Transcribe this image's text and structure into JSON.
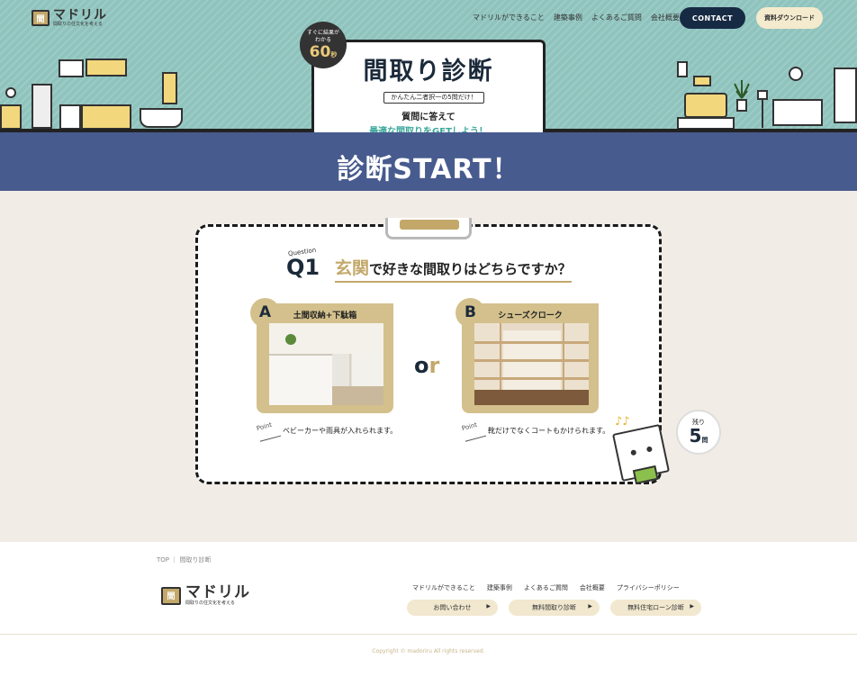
{
  "header": {
    "logo_mark": "間",
    "logo_main": "マドリル",
    "logo_sub": "間取りの住文化を考える",
    "nav": [
      "マドリルができること",
      "建築事例",
      "よくあるご質問",
      "会社概要"
    ],
    "contact": "CONTACT",
    "download": "資料ダウンロード"
  },
  "hero": {
    "badge_line1": "すぐに結果が",
    "badge_line2": "わかる",
    "badge_num": "60",
    "badge_unit": "秒",
    "title": "間取り診断",
    "tag": "かんたん二者択一の5問だけ！",
    "line1": "質問に答えて",
    "line2": "最適な間取りをGETしよう！",
    "start": "診断START！"
  },
  "question": {
    "label": "Question",
    "num": "Q1",
    "keyword": "玄関",
    "text": "で好きな間取りはどちらですか？",
    "or_o": "o",
    "or_r": "r",
    "options": [
      {
        "letter": "A",
        "title": "土間収納+下駄箱",
        "point_label": "Point",
        "point": "ベビーカーや雨具が入れられます。"
      },
      {
        "letter": "B",
        "title": "シューズクローク",
        "point_label": "Point",
        "point": "靴だけでなくコートもかけられます。"
      }
    ],
    "remaining_label": "残り",
    "remaining_num": "5",
    "remaining_unit": "問",
    "note_icon": "♪♪"
  },
  "footer": {
    "breadcrumb": "TOP ｜ 間取り診断",
    "logo_mark": "間",
    "logo_main": "マドリル",
    "logo_sub": "間取りの住文化を考える",
    "nav": [
      "マドリルができること",
      "建築事例",
      "よくあるご質問",
      "会社概要",
      "プライバシーポリシー"
    ],
    "buttons": [
      "お問い合わせ",
      "無料間取り診断",
      "無料住宅ローン診断"
    ],
    "arrow": "▶",
    "copyright": "Copyright © madoriru All rights reserved."
  },
  "colors": {
    "teal": "#8fc3bd",
    "navy": "#475b8e",
    "gold": "#c3a86a",
    "dark": "#172a44"
  }
}
